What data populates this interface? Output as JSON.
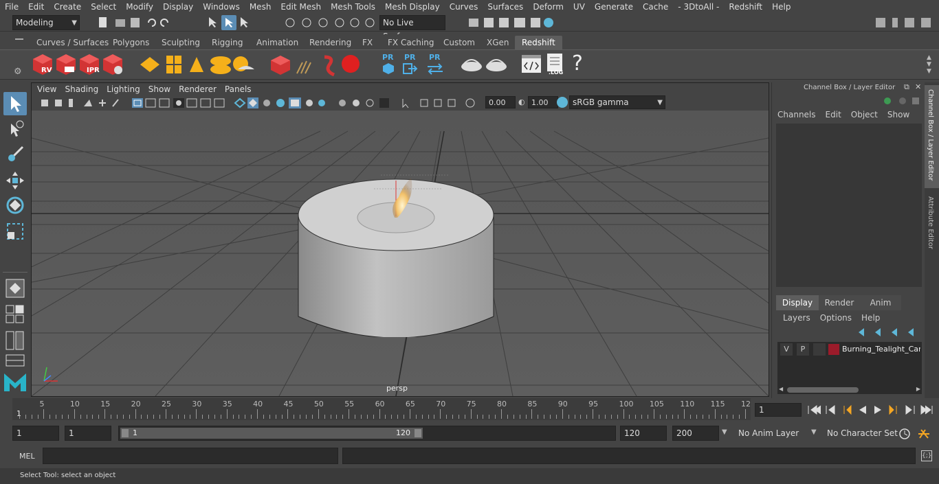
{
  "menubar": {
    "items": [
      "File",
      "Edit",
      "Create",
      "Select",
      "Modify",
      "Display",
      "Windows",
      "Mesh",
      "Edit Mesh",
      "Mesh Tools",
      "Mesh Display",
      "Curves",
      "Surfaces",
      "Deform",
      "UV",
      "Generate",
      "Cache",
      "- 3DtoAll -",
      "Redshift",
      "Help"
    ]
  },
  "status": {
    "mode": "Modeling",
    "live_surface": "No Live Surface"
  },
  "shelf": {
    "tabs": [
      "Curves / Surfaces",
      "Polygons",
      "Sculpting",
      "Rigging",
      "Animation",
      "Rendering",
      "FX",
      "FX Caching",
      "Custom",
      "XGen",
      "Redshift"
    ],
    "active_tab": "Redshift",
    "icon_labels": {
      "rv": "RV",
      "ipr": "IPR",
      "pr1": "PR",
      "pr2": "PR",
      "pr3": "PR",
      "log": ".LOG",
      "help": "?"
    }
  },
  "viewport": {
    "menu": [
      "View",
      "Shading",
      "Lighting",
      "Show",
      "Renderer",
      "Panels"
    ],
    "exposure": "0.00",
    "gamma": "1.00",
    "color_space": "sRGB gamma",
    "camera_label": "persp"
  },
  "channelbox": {
    "title": "Channel Box / Layer Editor",
    "menu": [
      "Channels",
      "Edit",
      "Object",
      "Show"
    ],
    "layer_tabs": [
      "Display",
      "Render",
      "Anim"
    ],
    "active_layer_tab": "Display",
    "layer_menu": [
      "Layers",
      "Options",
      "Help"
    ],
    "layer": {
      "v": "V",
      "p": "P",
      "name": "Burning_Tealight_Can",
      "color": "#9b1b2a"
    }
  },
  "sidetabs": [
    "Channel Box / Layer Editor",
    "Attribute Editor"
  ],
  "timeline": {
    "ticks": [
      "5",
      "10",
      "15",
      "20",
      "25",
      "30",
      "35",
      "40",
      "45",
      "50",
      "55",
      "60",
      "65",
      "70",
      "75",
      "80",
      "85",
      "90",
      "95",
      "100",
      "105",
      "110",
      "115",
      "12"
    ],
    "start_marker": "1",
    "current_frame": "1"
  },
  "range": {
    "start": "1",
    "playback_start": "1",
    "slider_start": "1",
    "slider_end": "120",
    "playback_end": "120",
    "end": "200",
    "anim_layer": "No Anim Layer",
    "character_set": "No Character Set"
  },
  "cmdline": {
    "label": "MEL"
  },
  "helpline": {
    "text": "Select Tool: select an object"
  }
}
